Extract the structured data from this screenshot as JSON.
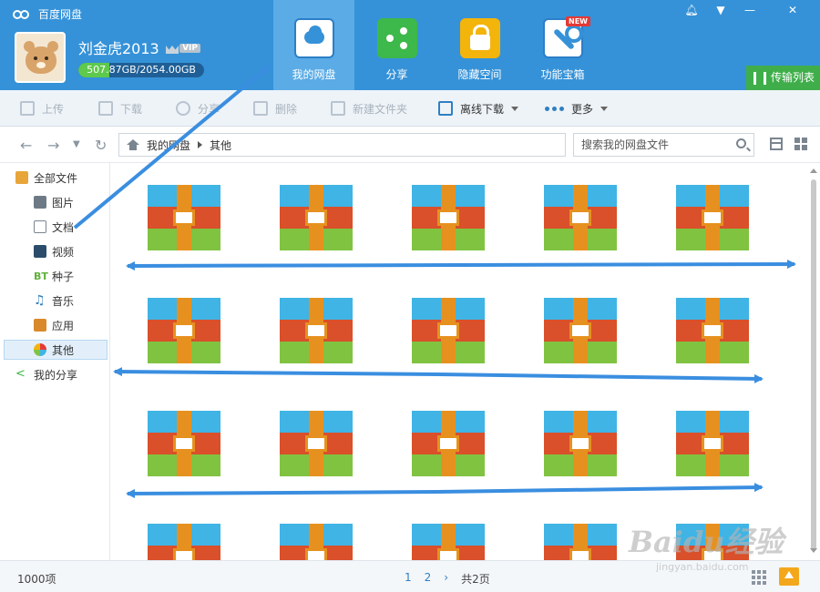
{
  "app": {
    "title": "百度网盘"
  },
  "window_controls": [
    "bell-icon",
    "menu-icon",
    "minimize-icon",
    "close-icon"
  ],
  "user": {
    "name": "刘金虎2013",
    "vip_label": "VIP",
    "quota_text": "507.87GB/2054.00GB",
    "quota_fraction": 0.247
  },
  "nav": [
    {
      "label": "我的网盘",
      "icon": "cloud-icon"
    },
    {
      "label": "分享",
      "icon": "share-icon"
    },
    {
      "label": "隐藏空间",
      "icon": "lock-icon"
    },
    {
      "label": "功能宝箱",
      "icon": "toolbox-icon"
    }
  ],
  "new_badge": "NEW",
  "transfer_list": "传输列表",
  "toolbar": {
    "upload": "上传",
    "download": "下载",
    "share": "分享",
    "delete": "删除",
    "new_folder": "新建文件夹",
    "offline_download": "离线下载",
    "more": "更多"
  },
  "breadcrumb": {
    "root": "我的网盘",
    "current": "其他"
  },
  "search": {
    "placeholder": "搜索我的网盘文件"
  },
  "sidebar": {
    "all_files": "全部文件",
    "items": [
      {
        "label": "图片",
        "icon": "image-icon"
      },
      {
        "label": "文档",
        "icon": "document-icon"
      },
      {
        "label": "视频",
        "icon": "video-icon"
      },
      {
        "label": "种子",
        "icon": "bt-icon",
        "badge": "BT"
      },
      {
        "label": "音乐",
        "icon": "music-icon"
      },
      {
        "label": "应用",
        "icon": "app-icon"
      },
      {
        "label": "其他",
        "icon": "other-icon",
        "active": true
      }
    ],
    "my_share": "我的分享"
  },
  "files": [
    {
      "name": ""
    },
    {
      "name": ""
    },
    {
      "name": ""
    },
    {
      "name": ""
    },
    {
      "name": ""
    },
    {
      "name": ""
    },
    {
      "name": ""
    },
    {
      "name": ""
    },
    {
      "name": ""
    },
    {
      "name": ""
    },
    {
      "name": ""
    },
    {
      "name": ""
    },
    {
      "name": ""
    },
    {
      "name": ""
    },
    {
      "name": ""
    },
    {
      "name": ""
    },
    {
      "name": ""
    },
    {
      "name": ""
    },
    {
      "name": ""
    },
    {
      "name": ""
    }
  ],
  "status": {
    "count": "1000项",
    "pages": [
      "1",
      "2"
    ],
    "next": "›",
    "total": "共2页"
  },
  "watermark": {
    "brand": "Baidu经验",
    "url": "jingyan.baidu.com"
  },
  "colors": {
    "header_blue": "#3592d8",
    "active_tab": "#5aabe6",
    "transfer_green": "#3fae4a",
    "annotation_arrow": "#3a8ee0"
  }
}
